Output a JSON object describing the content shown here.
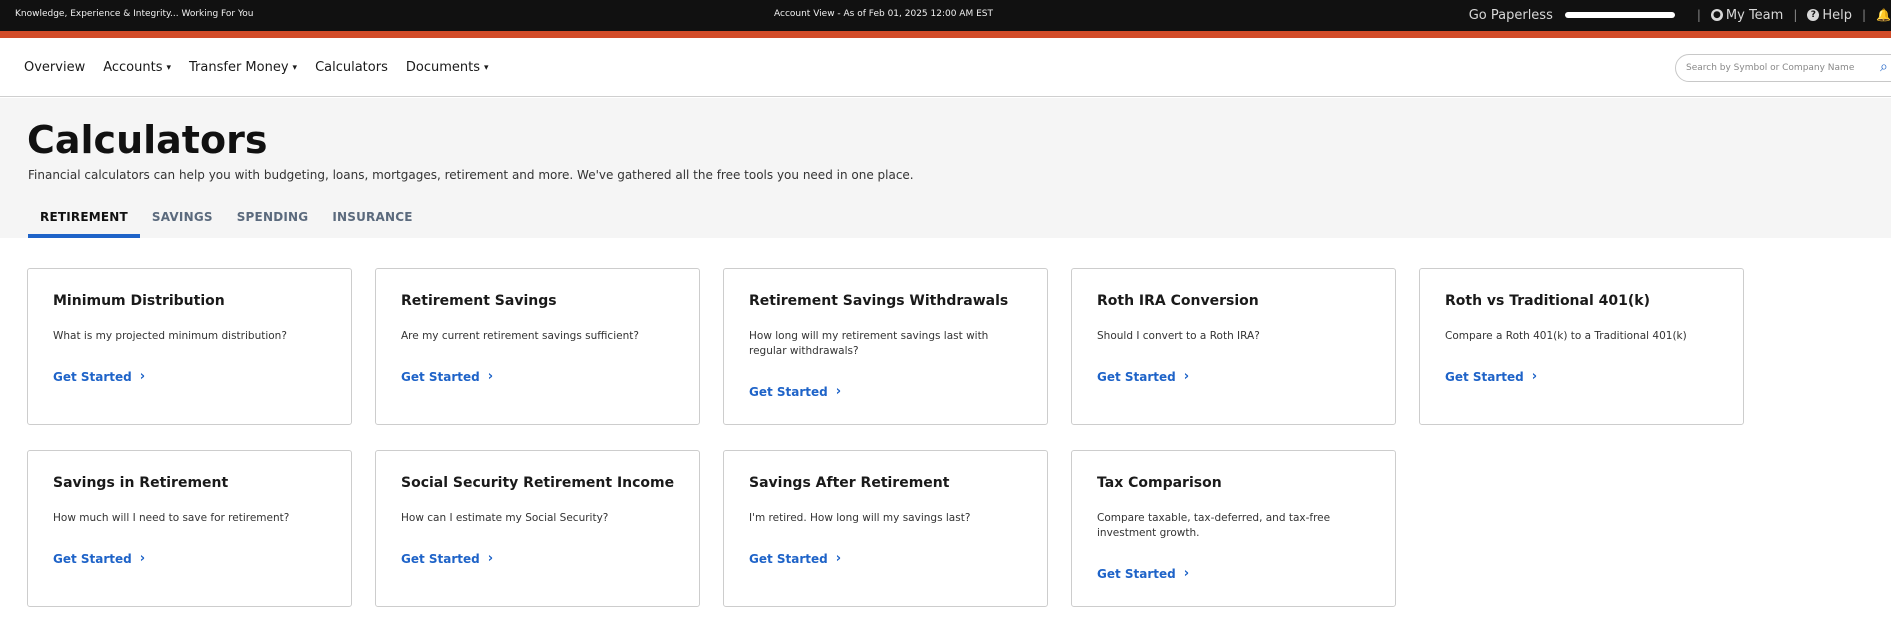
{
  "topbar": {
    "tagline": "Knowledge, Experience & Integrity... Working For You",
    "account_view": "Account View - As of Feb 01, 2025 12:00 AM EST",
    "go_paperless": "Go Paperless",
    "my_team": "My Team",
    "help": "Help",
    "icons": {
      "team": "user-circle-icon",
      "help": "question-circle-icon",
      "notifications": "bell-icon"
    }
  },
  "nav": {
    "items": [
      {
        "label": "Overview",
        "dropdown": false
      },
      {
        "label": "Accounts",
        "dropdown": true
      },
      {
        "label": "Transfer Money",
        "dropdown": true
      },
      {
        "label": "Calculators",
        "dropdown": false
      },
      {
        "label": "Documents",
        "dropdown": true
      }
    ],
    "search_placeholder": "Search by Symbol or Company Name"
  },
  "page": {
    "title": "Calculators",
    "description": "Financial calculators can help you with budgeting, loans, mortgages, retirement and more. We've gathered all the free tools you need in one place.",
    "tabs": [
      {
        "label": "RETIREMENT",
        "active": true
      },
      {
        "label": "SAVINGS",
        "active": false
      },
      {
        "label": "SPENDING",
        "active": false
      },
      {
        "label": "INSURANCE",
        "active": false
      }
    ]
  },
  "cards": [
    {
      "title": "Minimum Distribution",
      "description": "What is my projected minimum distribution?",
      "link": "Get Started"
    },
    {
      "title": "Retirement Savings",
      "description": "Are my current retirement savings sufficient?",
      "link": "Get Started"
    },
    {
      "title": "Retirement Savings Withdrawals",
      "description": "How long will my retirement savings last with regular withdrawals?",
      "link": "Get Started"
    },
    {
      "title": "Roth IRA Conversion",
      "description": "Should I convert to a Roth IRA?",
      "link": "Get Started"
    },
    {
      "title": "Roth vs Traditional 401(k)",
      "description": "Compare a Roth 401(k) to a Traditional 401(k)",
      "link": "Get Started"
    },
    {
      "title": "Savings in Retirement",
      "description": "How much will I need to save for retirement?",
      "link": "Get Started"
    },
    {
      "title": "Social Security Retirement Income",
      "description": "How can I estimate my Social Security?",
      "link": "Get Started"
    },
    {
      "title": "Savings After Retirement",
      "description": "I'm retired. How long will my savings last?",
      "link": "Get Started"
    },
    {
      "title": "Tax Comparison",
      "description": "Compare taxable, tax-deferred, and tax-free investment growth.",
      "link": "Get Started"
    }
  ],
  "colors": {
    "accent_strip": "#d24b28",
    "link_blue": "#1e63c8",
    "topbar_bg": "#111111"
  }
}
